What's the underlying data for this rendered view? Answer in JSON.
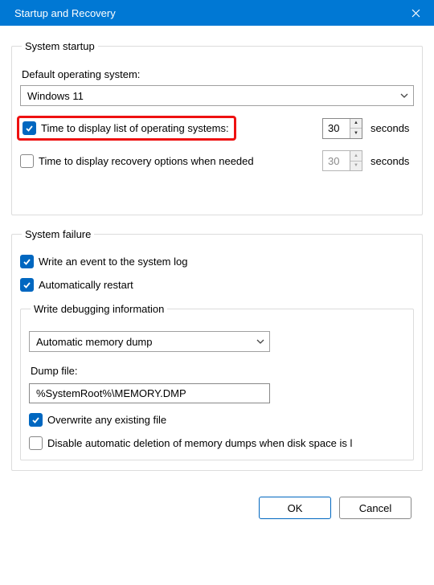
{
  "titlebar": {
    "title": "Startup and Recovery"
  },
  "startup": {
    "legend": "System startup",
    "default_os_label": "Default operating system:",
    "default_os_value": "Windows 11",
    "opt_os_list": {
      "checked": true,
      "label": "Time to display list of operating systems:",
      "value": "30",
      "unit": "seconds"
    },
    "opt_recovery": {
      "checked": false,
      "label": "Time to display recovery options when needed",
      "value": "30",
      "unit": "seconds"
    }
  },
  "failure": {
    "legend": "System failure",
    "write_event": {
      "checked": true,
      "label": "Write an event to the system log"
    },
    "auto_restart": {
      "checked": true,
      "label": "Automatically restart"
    },
    "debug": {
      "legend": "Write debugging information",
      "mode_value": "Automatic memory dump",
      "dump_label": "Dump file:",
      "dump_value": "%SystemRoot%\\MEMORY.DMP",
      "overwrite": {
        "checked": true,
        "label": "Overwrite any existing file"
      },
      "disable_del": {
        "checked": false,
        "label": "Disable automatic deletion of memory dumps when disk space is l"
      }
    }
  },
  "buttons": {
    "ok": "OK",
    "cancel": "Cancel"
  }
}
